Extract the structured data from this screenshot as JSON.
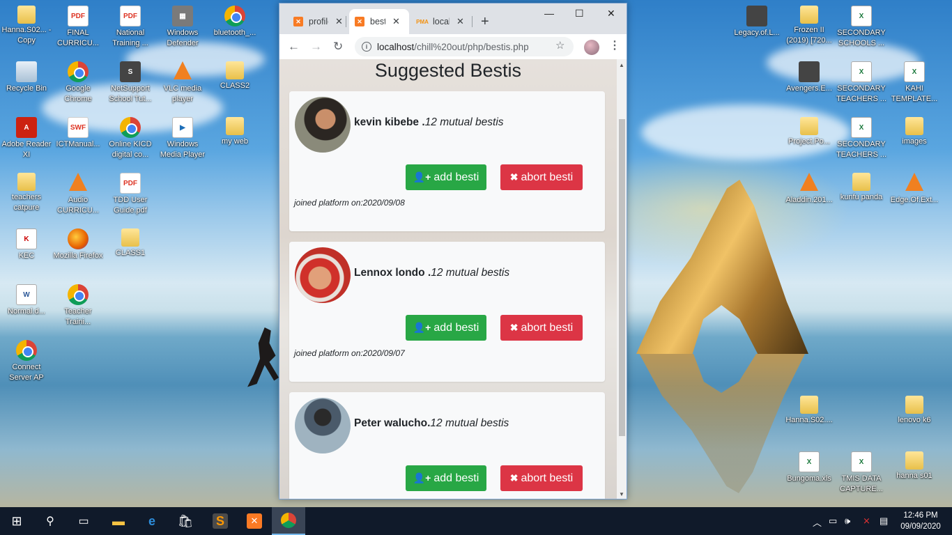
{
  "desktop": {
    "left_icons": [
      {
        "label": "Hanna.S02... - Copy",
        "icon": "folder-icon"
      },
      {
        "label": "FINAL CURRICU...",
        "icon": "pdf-icon"
      },
      {
        "label": "National Training ...",
        "icon": "pdf-icon"
      },
      {
        "label": "Windows Defender",
        "icon": "defender-icon"
      },
      {
        "label": "bluetooth_...",
        "icon": "chrome-icon"
      },
      {
        "label": "Recycle Bin",
        "icon": "recycle-bin-icon"
      },
      {
        "label": "Google Chrome",
        "icon": "chrome-icon"
      },
      {
        "label": "NetSupport School Tut...",
        "icon": "netsupport-icon"
      },
      {
        "label": "VLC media player",
        "icon": "vlc-icon"
      },
      {
        "label": "CLASS2",
        "icon": "folder-icon"
      },
      {
        "label": "Adobe Reader XI",
        "icon": "pdf-icon"
      },
      {
        "label": "ICTManual...",
        "icon": "swf-icon"
      },
      {
        "label": "Online KICD digital co...",
        "icon": "chrome-icon"
      },
      {
        "label": "Windows Media Player",
        "icon": "media-player-icon"
      },
      {
        "label": "my web",
        "icon": "folder-icon"
      },
      {
        "label": "teachers catpure",
        "icon": "folder-icon"
      },
      {
        "label": "Audio CURRICU...",
        "icon": "vlc-icon"
      },
      {
        "label": "TDD User Guide.pdf",
        "icon": "pdf-icon"
      },
      {
        "label": "KEC",
        "icon": "kec-icon"
      },
      {
        "label": "Mozilla Firefox",
        "icon": "firefox-icon"
      },
      {
        "label": "CLASS1",
        "icon": "folder-icon"
      },
      {
        "label": "Normal.d...",
        "icon": "word-icon"
      },
      {
        "label": "Teacher Traini...",
        "icon": "chrome-icon"
      },
      {
        "label": "Connect Server AP",
        "icon": "chrome-icon"
      }
    ],
    "right_icons": [
      {
        "label": "Legacy.of.L...",
        "icon": "video-icon"
      },
      {
        "label": "Frozen II (2019) [720...",
        "icon": "folder-icon"
      },
      {
        "label": "SECONDARY SCHOOLS ...",
        "icon": "excel-icon"
      },
      {
        "label": "Avengers.E...",
        "icon": "video-icon"
      },
      {
        "label": "SECONDARY TEACHERS ...",
        "icon": "excel-icon"
      },
      {
        "label": "KAHI TEMPLATE...",
        "icon": "excel-icon"
      },
      {
        "label": "Project.Po...",
        "icon": "folder-icon"
      },
      {
        "label": "SECONDARY TEACHERS ...",
        "icon": "excel-icon"
      },
      {
        "label": "images",
        "icon": "folder-icon"
      },
      {
        "label": "Aladdin.201...",
        "icon": "vlc-icon"
      },
      {
        "label": "kunfu panda",
        "icon": "folder-icon"
      },
      {
        "label": "Edge.Of.Ext...",
        "icon": "vlc-icon"
      },
      {
        "label": "Hanna.S02....",
        "icon": "folder-icon"
      },
      {
        "label": "lenovo k6",
        "icon": "folder-icon"
      },
      {
        "label": "Bungoma.xls",
        "icon": "excel-icon"
      },
      {
        "label": "TMIS DATA CAPTURE...",
        "icon": "excel-icon"
      },
      {
        "label": "hanna s01",
        "icon": "folder-icon"
      }
    ]
  },
  "browser": {
    "tabs": [
      {
        "label": "profile",
        "icon": "xampp-icon"
      },
      {
        "label": "bestis",
        "icon": "xampp-icon"
      },
      {
        "label": "localhost",
        "icon": "phpmyadmin-icon"
      }
    ],
    "new_tab": "+",
    "url_host": "localhost",
    "url_path": "/chill%20out/php/bestis.php",
    "page_title": "Suggested Bestis",
    "suggestions": [
      {
        "name": "kevin kibebe .",
        "mutual": "12 mutual bestis",
        "joined": "joined platform on:2020/09/08"
      },
      {
        "name": "Lennox londo .",
        "mutual": "12 mutual bestis",
        "joined": "joined platform on:2020/09/07"
      },
      {
        "name": "Peter walucho.",
        "mutual": "12 mutual bestis",
        "joined": ""
      }
    ],
    "add_label": "add besti",
    "abort_label": "abort besti"
  },
  "taskbar": {
    "time": "12:46 PM",
    "date": "09/09/2020"
  }
}
